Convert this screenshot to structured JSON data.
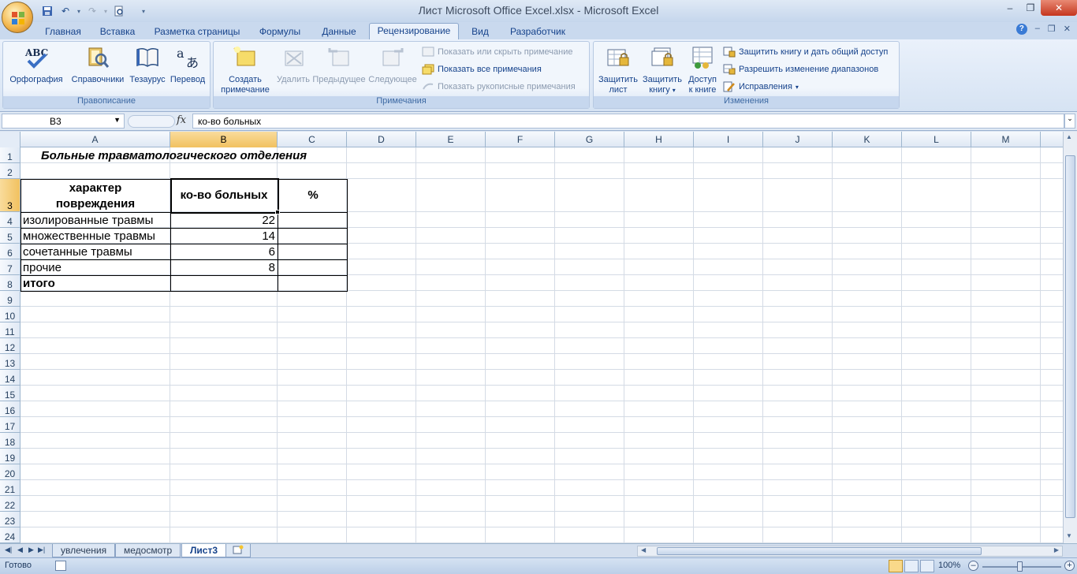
{
  "window": {
    "title": "Лист Microsoft Office Excel.xlsx - Microsoft Excel"
  },
  "ribbon_tabs": [
    "Главная",
    "Вставка",
    "Разметка страницы",
    "Формулы",
    "Данные",
    "Рецензирование",
    "Вид",
    "Разработчик"
  ],
  "active_tab": "Рецензирование",
  "ribbon": {
    "proofing": {
      "label": "Правописание",
      "spelling": "Орфография",
      "research": "Справочники",
      "thesaurus": "Тезаурус",
      "translate": "Перевод"
    },
    "comments": {
      "label": "Примечания",
      "new_line1": "Создать",
      "new_line2": "примечание",
      "delete": "Удалить",
      "previous": "Предыдущее",
      "next": "Следующее",
      "show_hide": "Показать или скрыть примечание",
      "show_all": "Показать все примечания",
      "show_ink": "Показать рукописные примечания"
    },
    "changes": {
      "label": "Изменения",
      "protect_sheet_line1": "Защитить",
      "protect_sheet_line2": "лист",
      "protect_book_line1": "Защитить",
      "protect_book_line2": "книгу",
      "share_line1": "Доступ",
      "share_line2": "к книге",
      "protect_share": "Защитить книгу и дать общий доступ",
      "allow_ranges": "Разрешить изменение диапазонов",
      "track_changes": "Исправления"
    }
  },
  "formula_bar": {
    "name_box": "B3",
    "fx": "fx",
    "content": "ко-во больных"
  },
  "columns": [
    "A",
    "B",
    "C",
    "D",
    "E",
    "F",
    "G",
    "H",
    "I",
    "J",
    "K",
    "L",
    "M"
  ],
  "rows": [
    "1",
    "2",
    "3",
    "4",
    "5",
    "6",
    "7",
    "8",
    "9",
    "10",
    "11",
    "12",
    "13",
    "14",
    "15",
    "16",
    "17",
    "18",
    "19",
    "20",
    "21",
    "22",
    "23",
    "24"
  ],
  "cells": {
    "title": "Больные травматологического отделения",
    "hdr_a_line1": "характер",
    "hdr_a_line2": "повреждения",
    "hdr_b": "ко-во больных",
    "hdr_c": "%",
    "r4a": "изолированные травмы",
    "r4b": "22",
    "r5a": "множественные травмы",
    "r5b": "14",
    "r6a": "сочетанные травмы",
    "r6b": "6",
    "r7a": "прочие",
    "r7b": "8",
    "r8a": "итого"
  },
  "sheet_tabs": [
    "увлечения",
    "медосмотр",
    "Лист3"
  ],
  "active_sheet": "Лист3",
  "status": {
    "ready": "Готово",
    "zoom": "100%"
  }
}
